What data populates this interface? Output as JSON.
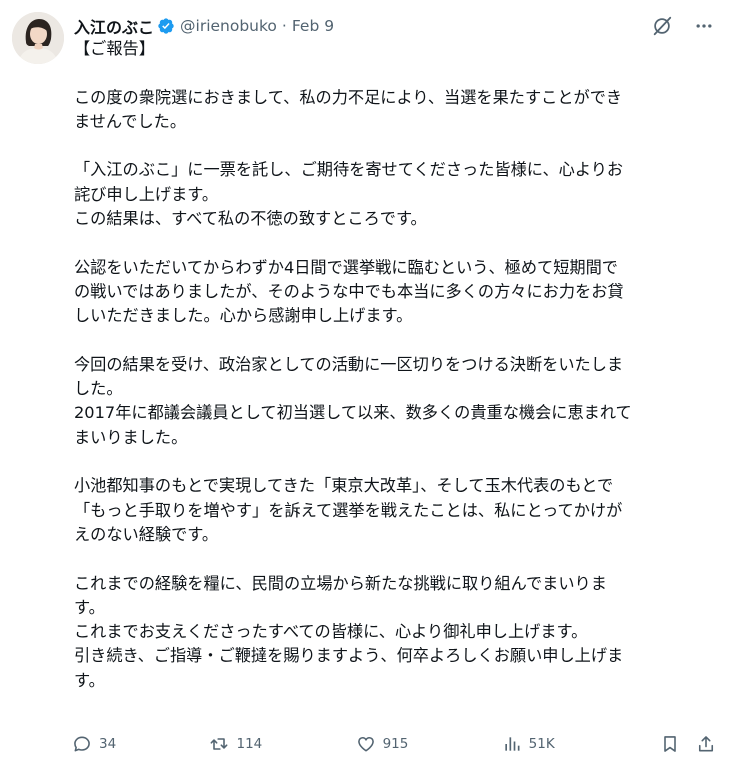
{
  "post": {
    "author_name": "入江のぶこ",
    "handle": "@irienobuko",
    "separator": "·",
    "date": "Feb 9"
  },
  "content": {
    "paragraphs": [
      [
        "【ご報告】"
      ],
      [
        "この度の衆院選におきまして、私の力不足により、当選を果たすことができ",
        "ませんでした。"
      ],
      [
        "「入江のぶこ」に一票を託し、ご期待を寄せてくださった皆様に、心よりお",
        "詫び申し上げます。",
        "この結果は、すべて私の不徳の致すところです。"
      ],
      [
        "公認をいただいてからわずか4日間で選挙戦に臨むという、極めて短期間で",
        "の戦いではありましたが、そのような中でも本当に多くの方々にお力をお貸",
        "しいただきました。心から感謝申し上げます。"
      ],
      [
        "今回の結果を受け、政治家としての活動に一区切りをつける決断をいたしま",
        "した。",
        "2017年に都議会議員として初当選して以来、数多くの貴重な機会に恵まれて",
        "まいりました。"
      ],
      [
        "小池都知事のもとで実現してきた「東京大改革」、そして玉木代表のもとで",
        "「もっと手取りを増やす」を訴えて選挙を戦えたことは、私にとってかけが",
        "えのない経験です。"
      ],
      [
        "これまでの経験を糧に、民間の立場から新たな挑戦に取り組んでまいりま",
        "す。",
        "これまでお支えくださったすべての皆様に、心より御礼申し上げます。",
        "引き続き、ご指導・ご鞭撻を賜りますよう、何卒よろしくお願い申し上げま",
        "す。"
      ]
    ]
  },
  "stats": {
    "replies": "34",
    "reposts": "114",
    "likes": "915",
    "views": "51K"
  },
  "icons": {
    "verified": "verified-badge-icon",
    "grok": "grok-icon",
    "more": "more-icon",
    "reply": "reply-icon",
    "repost": "repost-icon",
    "like": "like-icon",
    "views": "views-icon",
    "bookmark": "bookmark-icon",
    "share": "share-icon"
  },
  "colors": {
    "text": "#0f1419",
    "muted": "#536471",
    "verified": "#1d9bf0"
  }
}
